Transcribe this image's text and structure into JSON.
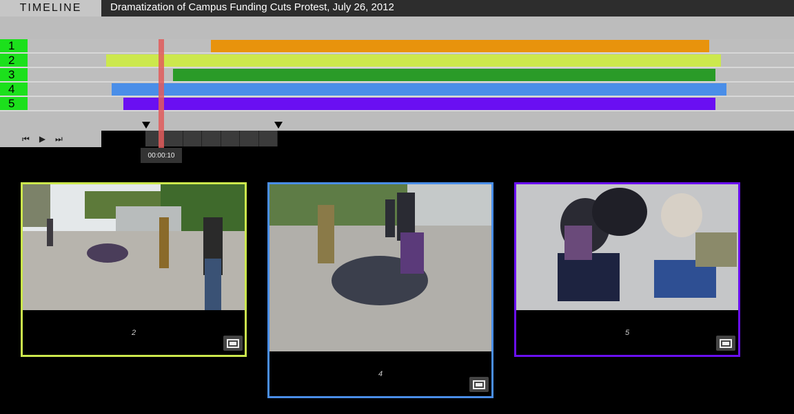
{
  "header": {
    "section_label": "TIMELINE",
    "title": "Dramatization of Campus Funding Cuts Protest, July 26, 2012"
  },
  "tracks": [
    {
      "label": "1",
      "color": "#e8930c",
      "start": 0.266,
      "end": 0.894
    },
    {
      "label": "2",
      "color": "#cce84d",
      "start": 0.134,
      "end": 0.908
    },
    {
      "label": "3",
      "color": "#2a9b28",
      "start": 0.218,
      "end": 0.901
    },
    {
      "label": "4",
      "color": "#4a8ee8",
      "start": 0.141,
      "end": 0.915
    },
    {
      "label": "5",
      "color": "#6a0ff2",
      "start": 0.155,
      "end": 0.901
    }
  ],
  "playhead": {
    "time": "00:00:10"
  },
  "controls": {
    "rewind_icon": "rewind-icon",
    "play_icon": "play-icon",
    "forward_icon": "fast-forward-icon",
    "rewind": "⏮",
    "play": "▶",
    "forward": "⏭"
  },
  "panels": [
    {
      "label": "2",
      "color": "#cce84d",
      "icon": "fullscreen-icon"
    },
    {
      "label": "4",
      "color": "#4a8ee8",
      "icon": "fullscreen-icon"
    },
    {
      "label": "5",
      "color": "#6a0ff2",
      "icon": "fullscreen-icon"
    }
  ]
}
